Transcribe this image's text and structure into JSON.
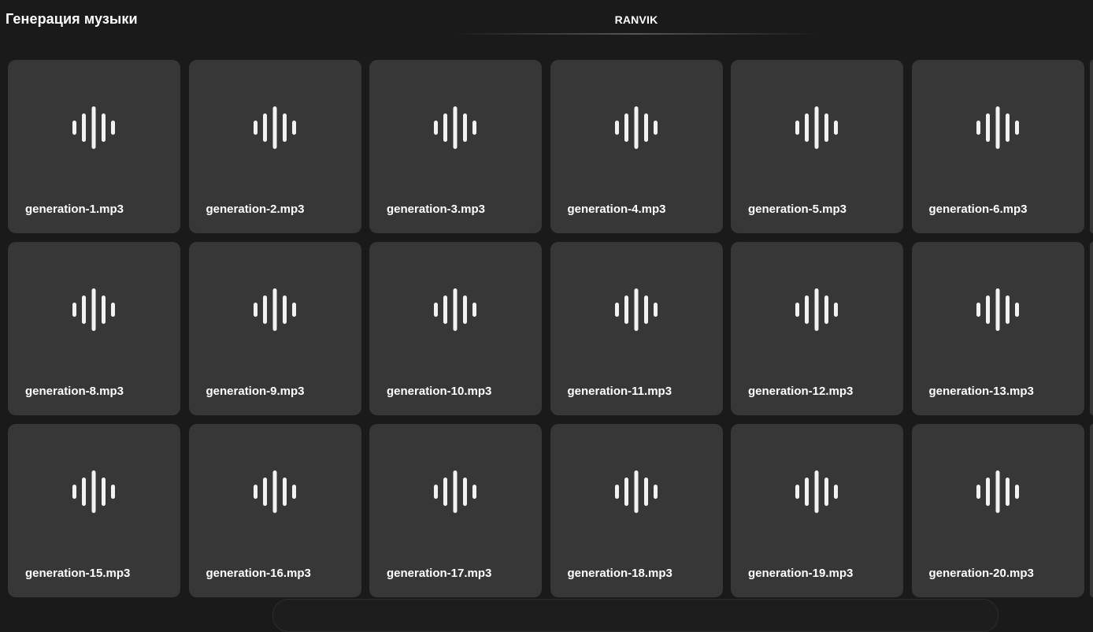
{
  "header": {
    "title": "Генерация музыки",
    "brand": "RANVIK"
  },
  "grid": {
    "card_icon": "sound-wave-icon",
    "items": [
      {
        "filename": "generation-1.mp3"
      },
      {
        "filename": "generation-2.mp3"
      },
      {
        "filename": "generation-3.mp3"
      },
      {
        "filename": "generation-4.mp3"
      },
      {
        "filename": "generation-5.mp3"
      },
      {
        "filename": "generation-6.mp3"
      },
      {
        "filename": "generation-8.mp3"
      },
      {
        "filename": "generation-9.mp3"
      },
      {
        "filename": "generation-10.mp3"
      },
      {
        "filename": "generation-11.mp3"
      },
      {
        "filename": "generation-12.mp3"
      },
      {
        "filename": "generation-13.mp3"
      },
      {
        "filename": "generation-15.mp3"
      },
      {
        "filename": "generation-16.mp3"
      },
      {
        "filename": "generation-17.mp3"
      },
      {
        "filename": "generation-18.mp3"
      },
      {
        "filename": "generation-19.mp3"
      },
      {
        "filename": "generation-20.mp3"
      }
    ]
  },
  "colors": {
    "background": "#1a1a1a",
    "card": "#373737",
    "text": "#ffffff",
    "icon": "#f2f2f2"
  }
}
